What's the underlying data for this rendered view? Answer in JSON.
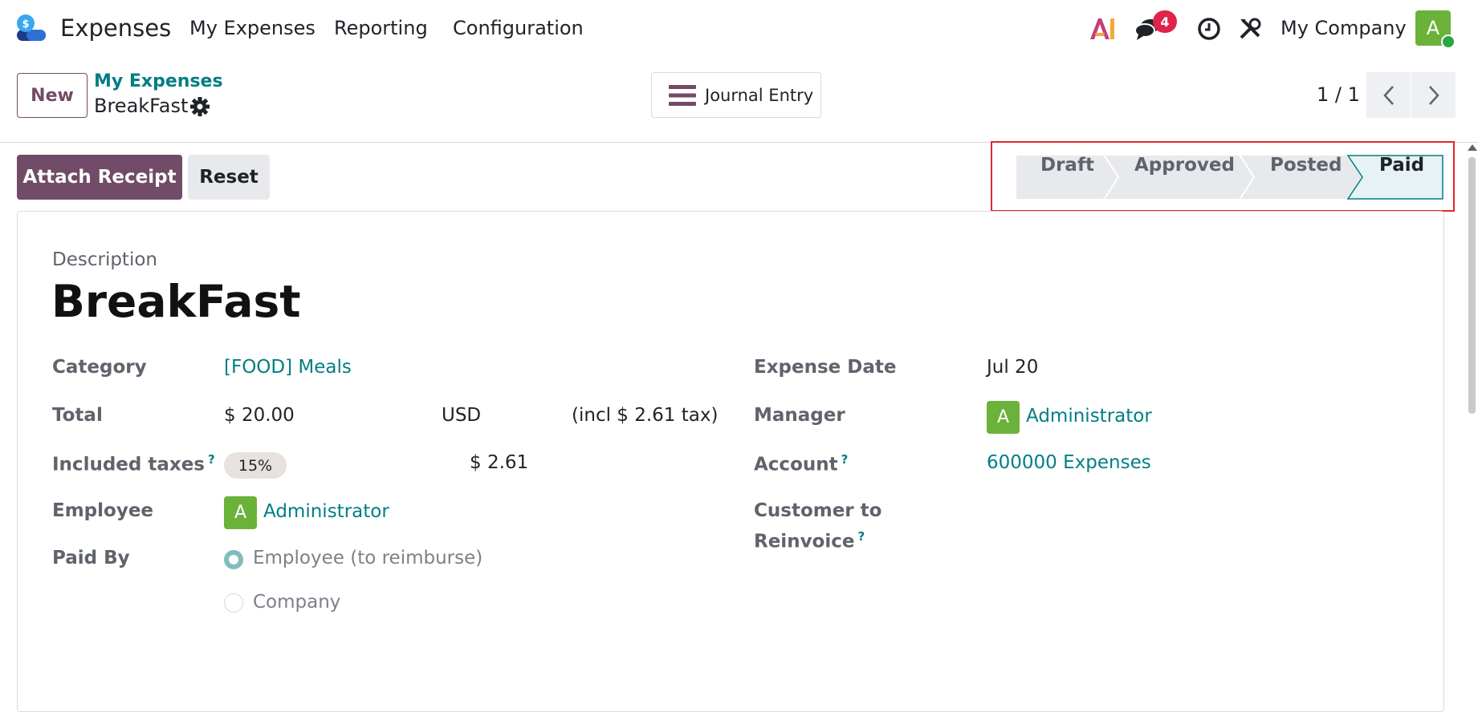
{
  "navbar": {
    "app_name": "Expenses",
    "menus": [
      "My Expenses",
      "Reporting",
      "Configuration"
    ],
    "message_count": "4",
    "company": "My Company",
    "user_initial": "A"
  },
  "control": {
    "new_label": "New",
    "breadcrumb_parent": "My Expenses",
    "breadcrumb_current": "BreakFast",
    "journal_entry_label": "Journal Entry",
    "pager_value": "1 / 1"
  },
  "statusbar": {
    "attach_receipt_label": "Attach Receipt",
    "reset_label": "Reset",
    "stages": [
      "Draft",
      "Approved",
      "Posted",
      "Paid"
    ],
    "active_stage": "Paid"
  },
  "form": {
    "description_label": "Description",
    "description": "BreakFast",
    "category_label": "Category",
    "category": "[FOOD] Meals",
    "total_label": "Total",
    "total": "$ 20.00",
    "currency": "USD",
    "total_tax_note": "(incl $ 2.61 tax)",
    "included_taxes_label": "Included taxes",
    "tax_tag": "15%",
    "tax_amount": "$ 2.61",
    "employee_label": "Employee",
    "employee_initial": "A",
    "employee": "Administrator",
    "paid_by_label": "Paid By",
    "paid_by_options": [
      "Employee (to reimburse)",
      "Company"
    ],
    "paid_by_selected": "Employee (to reimburse)",
    "expense_date_label": "Expense Date",
    "expense_date": "Jul 20",
    "manager_label": "Manager",
    "manager_initial": "A",
    "manager": "Administrator",
    "account_label": "Account",
    "account": "600000 Expenses",
    "customer_reinvoice_label_line1": "Customer to",
    "customer_reinvoice_label_line2": "Reinvoice",
    "help_mark": "?"
  },
  "colors": {
    "brand": "#714b67",
    "link": "#017e84",
    "avatar": "#6ab23a",
    "badge": "#e0234a",
    "highlight": "#e5262b"
  }
}
